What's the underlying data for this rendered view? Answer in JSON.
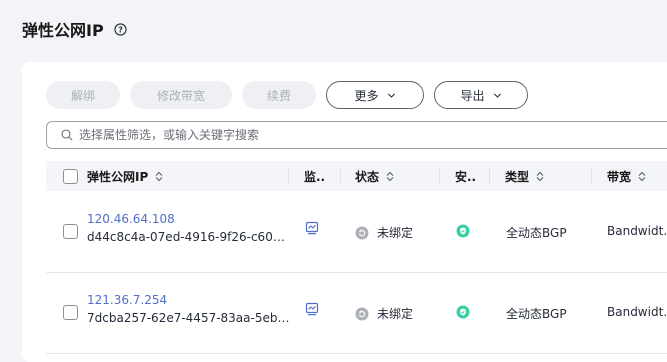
{
  "page": {
    "title": "弹性公网IP",
    "help_icon": "help-circle-icon"
  },
  "toolbar": {
    "unbind_label": "解绑",
    "modify_bandwidth_label": "修改带宽",
    "renew_label": "续费",
    "more_label": "更多",
    "export_label": "导出"
  },
  "search": {
    "placeholder": "选择属性筛选，或输入关键字搜索"
  },
  "table": {
    "headers": {
      "eip": "弹性公网IP",
      "monitor": "监..",
      "status": "状态",
      "security": "安..",
      "type": "类型",
      "bandwidth": "带宽"
    },
    "rows": [
      {
        "ip": "120.46.64.108",
        "id": "d44c8c4a-07ed-4916-9f26-c60…",
        "status": "未绑定",
        "type": "全动态BGP",
        "bandwidth": "Bandwidt…"
      },
      {
        "ip": "121.36.7.254",
        "id": "7dcba257-62e7-4457-83aa-5eb…",
        "status": "未绑定",
        "type": "全动态BGP",
        "bandwidth": "Bandwidt…"
      }
    ]
  },
  "colors": {
    "link": "#526ecc",
    "security_green": "#3dcca6",
    "status_gray": "#adb0b8"
  }
}
